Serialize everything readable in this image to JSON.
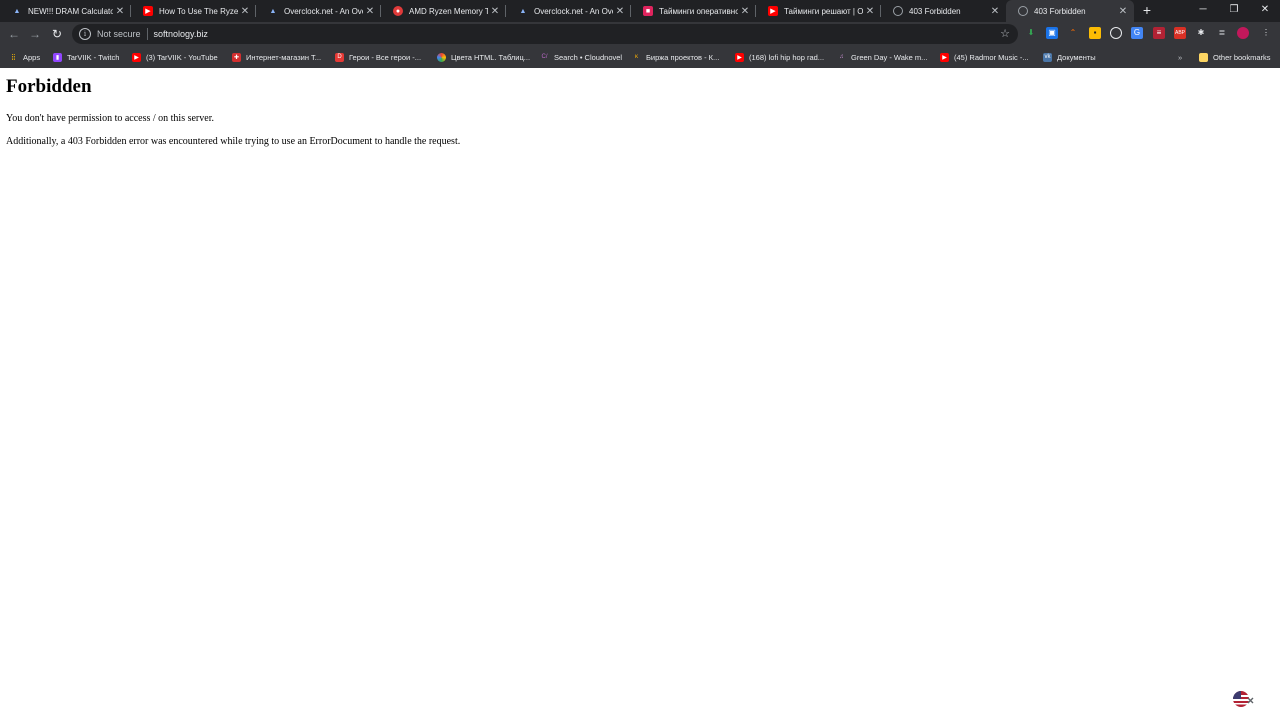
{
  "tabs": [
    {
      "title": "NEW!!! DRAM Calculator",
      "icon": "overclock-icon",
      "color": "#3c4a7a"
    },
    {
      "title": "How To Use The Ryzen D",
      "icon": "youtube-icon",
      "color": "#ff0000"
    },
    {
      "title": "Overclock.net - An Overc",
      "icon": "overclock-icon",
      "color": "#3c4a7a"
    },
    {
      "title": "AMD Ryzen Memory Twe",
      "icon": "amd-icon",
      "color": "#e03a3a"
    },
    {
      "title": "Overclock.net - An Overc",
      "icon": "overclock-icon",
      "color": "#3c4a7a"
    },
    {
      "title": "Тайминги оперативной",
      "icon": "bookmark-red-icon",
      "color": "#e0245e"
    },
    {
      "title": "Тайминги решают | Onc",
      "icon": "youtube-icon",
      "color": "#ff0000"
    },
    {
      "title": "403 Forbidden",
      "icon": "globe-icon",
      "color": "#9aa0a6"
    },
    {
      "title": "403 Forbidden",
      "icon": "globe-icon",
      "color": "#9aa0a6"
    }
  ],
  "toolbar": {
    "security_label": "Not secure",
    "url": "softnology.biz"
  },
  "bookmarks": [
    {
      "label": "Apps",
      "icon": "apps-grid-icon",
      "color": "#4285f4"
    },
    {
      "label": "TarVIIK - Twitch",
      "icon": "twitch-icon",
      "color": "#9146ff"
    },
    {
      "label": "(3) TarVIIK - YouTube",
      "icon": "youtube-icon",
      "color": "#ff0000"
    },
    {
      "label": "Интернет-магазин Т...",
      "icon": "shop-icon",
      "color": "#d32f2f"
    },
    {
      "label": "Герои - Все герои -...",
      "icon": "dota-icon",
      "color": "#e53935"
    },
    {
      "label": "Цвета HTML. Таблиц...",
      "icon": "color-wheel-icon",
      "color": "#8e24aa"
    },
    {
      "label": "Search • Cloudnovel",
      "icon": "cloudnovel-icon",
      "color": "#7b1fa2"
    },
    {
      "label": "Биржа проектов - К...",
      "icon": "kwork-icon",
      "color": "#ffb300"
    },
    {
      "label": "(168) lofi hip hop rad...",
      "icon": "youtube-icon",
      "color": "#ff0000"
    },
    {
      "label": "Green Day - Wake m...",
      "icon": "music-icon",
      "color": "#8e24aa"
    },
    {
      "label": "(45) Radmor Music -...",
      "icon": "youtube-icon",
      "color": "#ff0000"
    },
    {
      "label": "Документы",
      "icon": "vk-icon",
      "color": "#4a76a8"
    }
  ],
  "other_bookmarks": "Other bookmarks",
  "page": {
    "heading": "Forbidden",
    "line1": "You don't have permission to access / on this server.",
    "line2": "Additionally, a 403 Forbidden error was encountered while trying to use an ErrorDocument to handle the request."
  }
}
